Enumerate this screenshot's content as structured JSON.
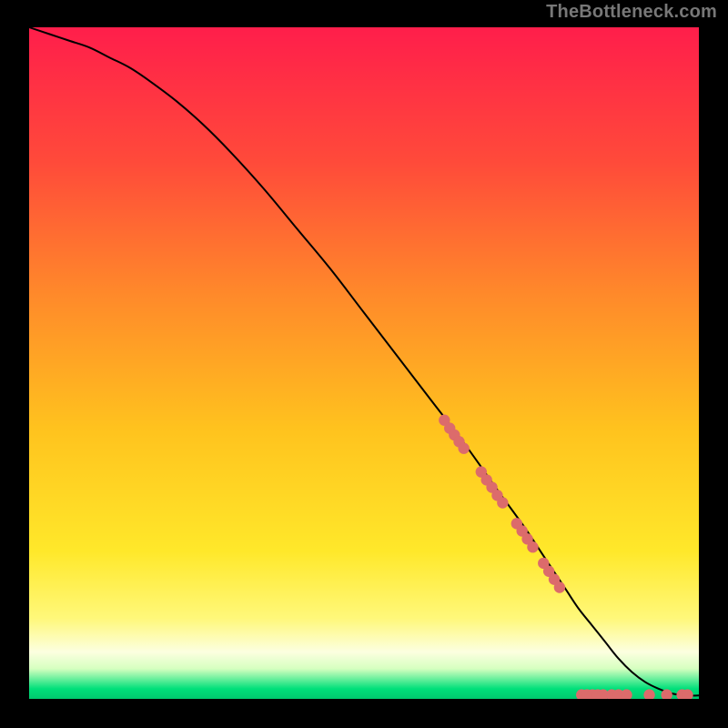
{
  "watermark": "TheBottleneck.com",
  "colors": {
    "background": "#000000",
    "curve": "#000000",
    "marker": "#dc6b6b",
    "gradient_stops": [
      {
        "offset": 0.0,
        "color": "#ff1e4b"
      },
      {
        "offset": 0.2,
        "color": "#ff4a3a"
      },
      {
        "offset": 0.4,
        "color": "#ff8a2a"
      },
      {
        "offset": 0.6,
        "color": "#ffc31e"
      },
      {
        "offset": 0.78,
        "color": "#ffe82a"
      },
      {
        "offset": 0.88,
        "color": "#fff87a"
      },
      {
        "offset": 0.93,
        "color": "#fcffe0"
      },
      {
        "offset": 0.955,
        "color": "#d6ffc0"
      },
      {
        "offset": 0.985,
        "color": "#00e07a"
      },
      {
        "offset": 1.0,
        "color": "#00c86e"
      }
    ]
  },
  "chart_data": {
    "type": "line",
    "title": "",
    "xlabel": "",
    "ylabel": "",
    "xlim": [
      0,
      100
    ],
    "ylim": [
      0,
      100
    ],
    "series": [
      {
        "name": "curve",
        "x": [
          0,
          3,
          6,
          9,
          12,
          15,
          18,
          22,
          26,
          30,
          35,
          40,
          45,
          50,
          55,
          60,
          65,
          70,
          74,
          77,
          80,
          82,
          84,
          86,
          88,
          90,
          92,
          94,
          96,
          98,
          100
        ],
        "y": [
          100,
          99,
          98,
          97,
          95.5,
          94,
          92,
          89,
          85.5,
          81.5,
          76,
          70,
          64,
          57.5,
          51,
          44.5,
          38,
          31,
          25.5,
          21,
          16.5,
          13.5,
          11,
          8.5,
          6,
          4,
          2.5,
          1.5,
          0.8,
          0.5,
          0.5
        ]
      }
    ],
    "markers": [
      {
        "x": 62.0,
        "y": 41.5
      },
      {
        "x": 62.8,
        "y": 40.3
      },
      {
        "x": 63.5,
        "y": 39.3
      },
      {
        "x": 64.2,
        "y": 38.3
      },
      {
        "x": 64.9,
        "y": 37.3
      },
      {
        "x": 67.5,
        "y": 33.8
      },
      {
        "x": 68.3,
        "y": 32.6
      },
      {
        "x": 69.1,
        "y": 31.5
      },
      {
        "x": 69.9,
        "y": 30.3
      },
      {
        "x": 70.7,
        "y": 29.2
      },
      {
        "x": 72.8,
        "y": 26.1
      },
      {
        "x": 73.6,
        "y": 25.0
      },
      {
        "x": 74.4,
        "y": 23.8
      },
      {
        "x": 75.2,
        "y": 22.6
      },
      {
        "x": 76.8,
        "y": 20.2
      },
      {
        "x": 77.6,
        "y": 19.0
      },
      {
        "x": 78.4,
        "y": 17.8
      },
      {
        "x": 79.2,
        "y": 16.6
      },
      {
        "x": 82.5,
        "y": 0.6
      },
      {
        "x": 83.3,
        "y": 0.6
      },
      {
        "x": 84.1,
        "y": 0.6
      },
      {
        "x": 84.9,
        "y": 0.6
      },
      {
        "x": 85.7,
        "y": 0.6
      },
      {
        "x": 87.0,
        "y": 0.6
      },
      {
        "x": 88.0,
        "y": 0.6
      },
      {
        "x": 89.2,
        "y": 0.6
      },
      {
        "x": 92.6,
        "y": 0.6
      },
      {
        "x": 95.2,
        "y": 0.6
      },
      {
        "x": 97.5,
        "y": 0.6
      },
      {
        "x": 98.3,
        "y": 0.6
      }
    ]
  }
}
